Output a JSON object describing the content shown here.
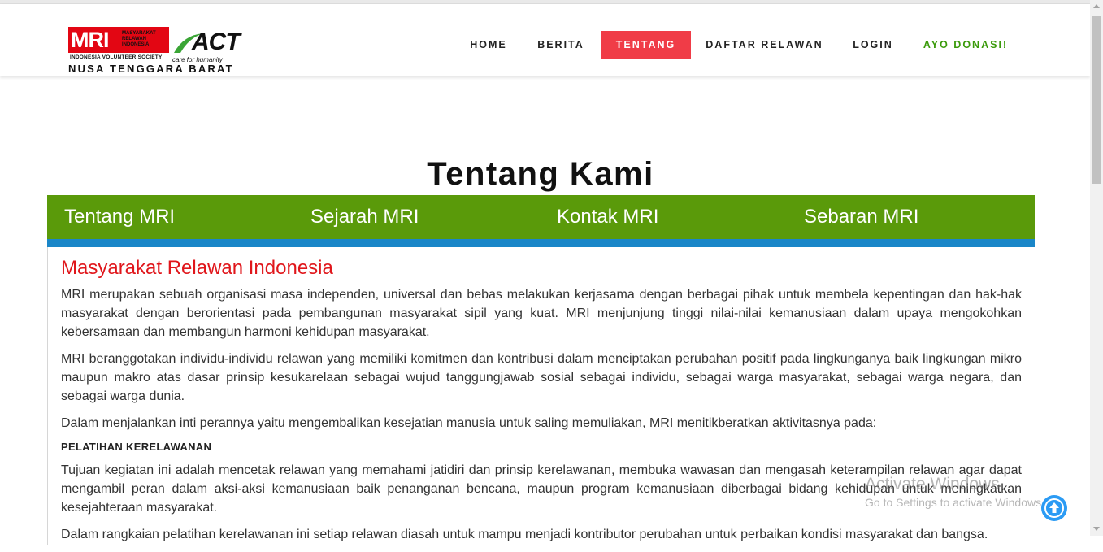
{
  "header": {
    "logo": {
      "mri": "MRI",
      "mri_sub": [
        "MASYARAKAT",
        "RELAWAN",
        "INDONESIA"
      ],
      "society": "INDONESIA VOLUNTEER SOCIETY",
      "act": "ACT",
      "act_tagline": "care for humanity",
      "region": "NUSA TENGGARA BARAT"
    },
    "nav": [
      {
        "label": "HOME",
        "active": false
      },
      {
        "label": "BERITA",
        "active": false
      },
      {
        "label": "TENTANG",
        "active": true
      },
      {
        "label": "DAFTAR RELAWAN",
        "active": false
      },
      {
        "label": "LOGIN",
        "active": false
      },
      {
        "label": "AYO DONASI!",
        "active": false
      }
    ]
  },
  "page_title": "Tentang Kami",
  "tabs": [
    "Tentang MRI",
    "Sejarah MRI",
    "Kontak MRI",
    "Sebaran MRI"
  ],
  "content": {
    "heading": "Masyarakat Relawan Indonesia",
    "para1": "MRI merupakan sebuah organisasi masa independen, universal dan bebas melakukan kerjasama dengan berbagai pihak untuk membela kepentingan dan hak-hak masyarakat dengan berorientasi pada pembangunan masyarakat sipil yang kuat. MRI menjunjung tinggi nilai-nilai kemanusiaan dalam upaya mengokohkan kebersamaan dan membangun harmoni kehidupan masyarakat.",
    "para2": "MRI beranggotakan individu-individu relawan yang memiliki komitmen dan kontribusi dalam menciptakan perubahan positif pada lingkunganya baik lingkungan mikro maupun makro atas dasar prinsip kesukarelaan sebagai wujud tanggungjawab sosial sebagai individu, sebagai warga masyarakat, sebagai warga negara, dan sebagai warga dunia.",
    "para3": "Dalam menjalankan inti perannya yaitu mengembalikan kesejatian manusia untuk saling memuliakan, MRI menitikberatkan aktivitasnya pada:",
    "subheading": "PELATIHAN KERELAWANAN",
    "para4": "Tujuan kegiatan ini adalah mencetak relawan yang memahami jatidiri dan prinsip kerelawanan, membuka wawasan dan mengasah keterampilan relawan agar dapat mengambil peran dalam aksi-aksi kemanusiaan baik penanganan bencana, maupun program kemanusiaan diberbagai bidang kehidupan untuk meningkatkan kesejahteraan masyarakat.",
    "para5": "Dalam rangkaian pelatihan kerelawanan ini setiap relawan diasah untuk mampu menjadi kontributor perubahan untuk perbaikan kondisi masyarakat dan bangsa."
  },
  "watermark": {
    "line1": "Activate Windows",
    "line2": "Go to Settings to activate Windows."
  },
  "colors": {
    "accent_red": "#f03c47",
    "tab_green": "#5a9a0a",
    "tab_blue": "#1a86c8",
    "heading_red": "#e0161b",
    "donate_green": "#3a9a0a",
    "scroll_top_blue": "#2b9bf4"
  },
  "icons": {
    "scroll_top": "arrow-up-circle-icon",
    "scrollbar_up": "chevron-up-icon",
    "scrollbar_down": "chevron-down-icon"
  }
}
